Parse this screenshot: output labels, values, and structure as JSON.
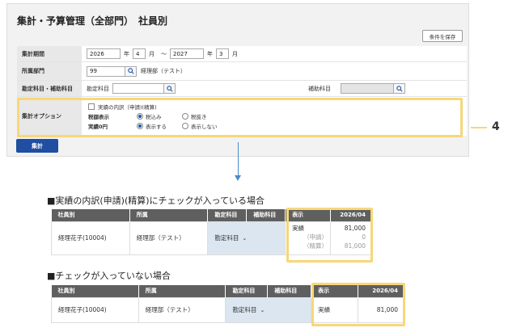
{
  "panel": {
    "title": "集計・予算管理（全部門）　社員別",
    "save_button": "条件を保存",
    "rows": {
      "period": {
        "label": "集計期間",
        "from_year": "2026",
        "year_unit": "年",
        "from_month": "4",
        "month_unit": "月",
        "tilde": "〜",
        "to_year": "2027",
        "to_month": "3"
      },
      "dept": {
        "label": "所属部門",
        "value": "99",
        "name": "経理部（テスト）"
      },
      "account": {
        "label": "勘定科目・補助科目",
        "account_placeholder": "勘定科目",
        "sub_label": "補助科目"
      },
      "options": {
        "label": "集計オプション",
        "checkbox_label": "実績の内訳（申請)(精算)",
        "tax_label": "税額表示",
        "tax_opt1": "税込み",
        "tax_opt2": "税抜き",
        "zero_label": "実績0円",
        "zero_opt1": "表示する",
        "zero_opt2": "表示しない"
      }
    },
    "run_button": "集計"
  },
  "callout": {
    "number": "4"
  },
  "section1": {
    "title": "■実績の内訳(申請)(精算)にチェックが入っている場合",
    "headers": [
      "社員別",
      "所属",
      "勘定科目",
      "補助科目",
      "表示",
      "2026/04"
    ],
    "row": {
      "employee": "経理花子(10004)",
      "dept": "経理部（テスト）",
      "account": "勘定科目",
      "display_main": "実績",
      "value_main": "81,000",
      "display_sub1": "（申請）",
      "value_sub1": "0",
      "display_sub2": "（精算）",
      "value_sub2": "81,000"
    }
  },
  "section2": {
    "title": "■チェックが入っていない場合",
    "headers": [
      "社員別",
      "所属",
      "勘定科目",
      "補助科目",
      "表示",
      "2026/04"
    ],
    "row": {
      "employee": "経理花子(10004)",
      "dept": "経理部（テスト）",
      "account": "勘定科目",
      "display_main": "実績",
      "value_main": "81,000"
    }
  },
  "colors": {
    "accent": "#1f4ea3",
    "highlight": "#f6d77a",
    "header_bg": "#5f5f5f",
    "cell_blue": "#dbe6f1"
  }
}
